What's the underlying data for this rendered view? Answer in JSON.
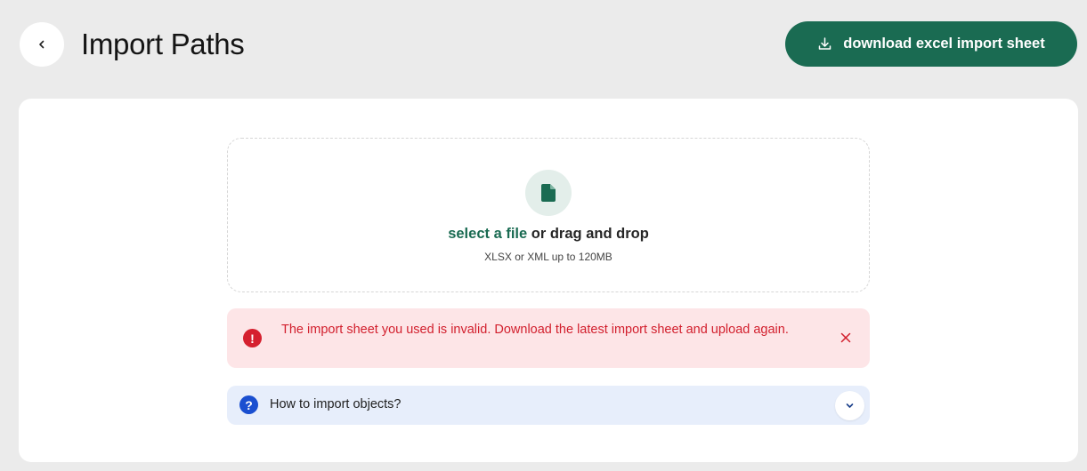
{
  "header": {
    "title": "Import Paths",
    "back_icon": "chevron-left-icon",
    "download_label": "download excel import sheet",
    "download_icon": "download-icon"
  },
  "upload": {
    "icon": "file-icon",
    "select_link": "select a file",
    "drop_text": " or drag and drop",
    "hint": "XLSX or XML up to 120MB"
  },
  "error": {
    "icon": "alert-circle-icon",
    "icon_glyph": "!",
    "message": "The import sheet you used is invalid. Download the latest import sheet and upload again.",
    "close_icon": "close-icon"
  },
  "faq": {
    "icon": "help-circle-icon",
    "icon_glyph": "?",
    "label": "How to import objects?",
    "toggle_icon": "chevron-down-icon"
  },
  "colors": {
    "accent": "#1a6b52",
    "error_text": "#d21f2d",
    "error_bg": "#fde5e7",
    "info_bg": "#e7eefb",
    "info_icon": "#1a4fd0"
  }
}
